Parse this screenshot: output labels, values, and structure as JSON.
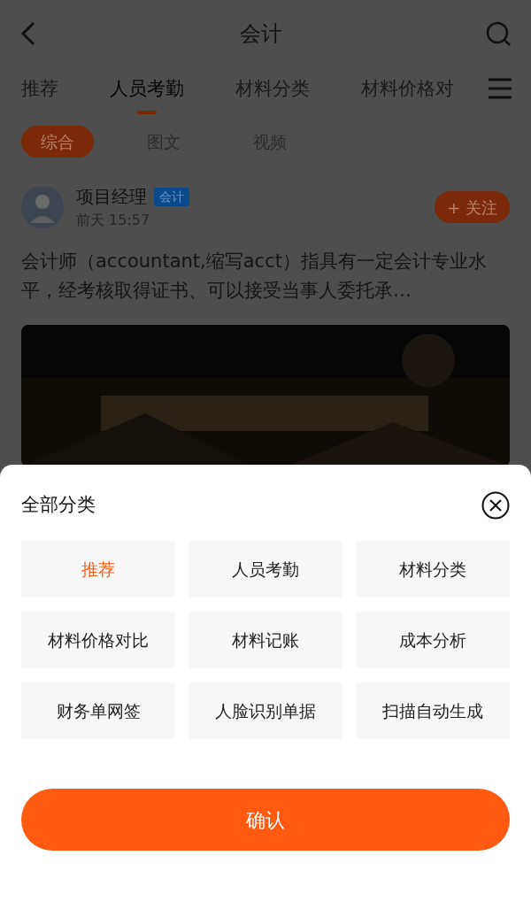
{
  "header": {
    "title": "会计"
  },
  "tabs": [
    {
      "label": "推荐",
      "selected": false
    },
    {
      "label": "人员考勤",
      "selected": true
    },
    {
      "label": "材料分类",
      "selected": false
    },
    {
      "label": "材料价格对",
      "selected": false
    }
  ],
  "filters": [
    {
      "label": "综合",
      "selected": true
    },
    {
      "label": "图文",
      "selected": false
    },
    {
      "label": "视频",
      "selected": false
    }
  ],
  "post": {
    "author": "项目经理",
    "tag": "会计",
    "time": "前天 15:57",
    "follow": "+ 关注",
    "text": "会计师（accountant,缩写acct）指具有一定会计专业水平，经考核取得证书、可以接受当事人委托承…"
  },
  "sheet": {
    "title": "全部分类",
    "categories": [
      {
        "label": "推荐",
        "selected": true
      },
      {
        "label": "人员考勤",
        "selected": false
      },
      {
        "label": "材料分类",
        "selected": false
      },
      {
        "label": "材料价格对比",
        "selected": false
      },
      {
        "label": "材料记账",
        "selected": false
      },
      {
        "label": "成本分析",
        "selected": false
      },
      {
        "label": "财务单网签",
        "selected": false
      },
      {
        "label": "人脸识别单据",
        "selected": false
      },
      {
        "label": "扫描自动生成",
        "selected": false
      }
    ],
    "confirm": "确认"
  }
}
